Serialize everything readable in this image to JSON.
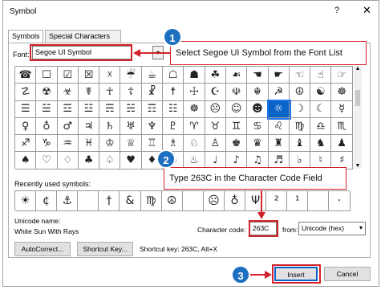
{
  "dialog": {
    "title": "Symbol",
    "help_label": "?",
    "close_label": "✕"
  },
  "tabs": [
    {
      "label": "Symbols",
      "active": true
    },
    {
      "label": "Special Characters",
      "active": false
    }
  ],
  "font": {
    "label": "Font:",
    "value": "Segoe UI Symbol",
    "dropdown_arrow": "▾"
  },
  "symbol_grid": [
    [
      "☎",
      "☐",
      "☑",
      "☒",
      "☓",
      "☔",
      "☕",
      "☖",
      "☗",
      "☘",
      "☙",
      "☚",
      "☛",
      "☜",
      "☝",
      "☞"
    ],
    [
      "☡",
      "☢",
      "☣",
      "☤",
      "☥",
      "☦",
      "☧",
      "☨",
      "☩",
      "☪",
      "☫",
      "☬",
      "☭",
      "☮",
      "☯",
      "☸"
    ],
    [
      "☰",
      "☱",
      "☲",
      "☳",
      "☴",
      "☵",
      "☶",
      "☷",
      "☸",
      "☹",
      "☺",
      "☻",
      "☼",
      "☽",
      "☾",
      "☿"
    ],
    [
      "♀",
      "♁",
      "♂",
      "♃",
      "♄",
      "♅",
      "♆",
      "♇",
      "♈",
      "♉",
      "♊",
      "♋",
      "♌",
      "♍",
      "♎",
      "♏"
    ],
    [
      "♐",
      "♑",
      "♒",
      "♓",
      "♔",
      "♕",
      "♖",
      "♗",
      "♘",
      "♙",
      "♚",
      "♛",
      "♜",
      "♝",
      "♞",
      "♟"
    ],
    [
      "♠",
      "♡",
      "♢",
      "♣",
      "♤",
      "♥",
      "♦",
      "♧",
      "♨",
      "♩",
      "♪",
      "♫",
      "♬",
      "♭",
      "♮",
      "♯"
    ]
  ],
  "selected_cell": {
    "row": 2,
    "col": 12
  },
  "recent": {
    "label": "Recently used symbols:",
    "symbols": [
      "☀",
      "¢",
      "⚓",
      "",
      "†",
      "&",
      "♍",
      "☮",
      "",
      "☹",
      "♁",
      "Ψ",
      "²",
      "¹",
      "",
      "·"
    ]
  },
  "unicode": {
    "name_label": "Unicode name:",
    "name": "White Sun With Rays"
  },
  "character_code": {
    "label": "Character code:",
    "value": "263C"
  },
  "from": {
    "label": "from:",
    "value": "Unicode (hex)",
    "arrow": "▾"
  },
  "buttons": {
    "autocorrect": "AutoCorrect...",
    "shortcut_key": "Shortcut Key...",
    "insert": "Insert",
    "cancel": "Cancel"
  },
  "shortcut_info": "Shortcut key: 263C, Alt+X",
  "annotations": {
    "step1_number": "1",
    "step1_text": "Select Segoe UI Symbol from the Font List",
    "step2_number": "2",
    "step2_text": "Type 263C in the Character Code Field",
    "step3_number": "3"
  },
  "colors": {
    "annotation_red": "#d4222a",
    "badge_blue": "#1d6fc0",
    "selection_blue": "#0a64c8"
  }
}
